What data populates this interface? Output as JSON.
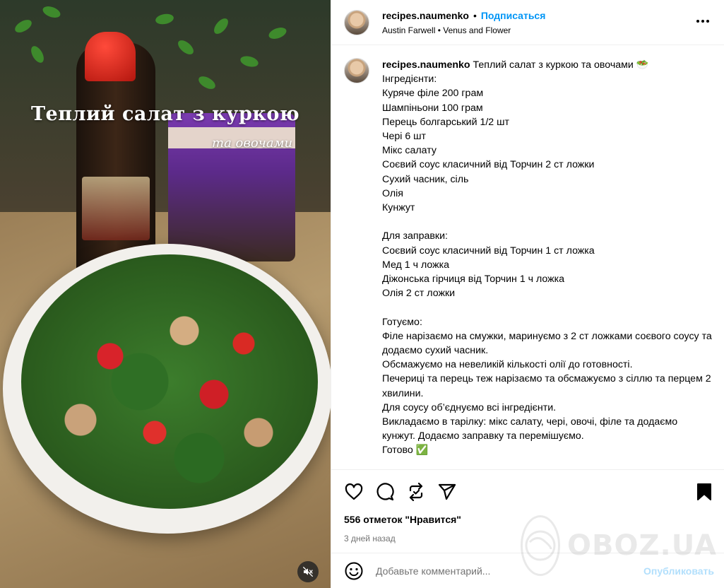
{
  "post": {
    "username": "recipes.naumenko",
    "follow_label": "Подписаться",
    "separator": "•",
    "audio": "Austin Farwell • Venus and Flower",
    "media_overlay_title": "Теплий салат з куркою",
    "media_overlay_subtitle": "та овочами"
  },
  "caption": {
    "title": "Теплий салат з куркою та овочами 🥗",
    "text": "Інгредієнти:\nКуряче філе 200 грам\nШампіньони 100 грам\nПерець болгарський 1/2 шт\nЧері 6 шт\nМікс салату\nСоєвий соус класичний від Торчин 2 ст ложки\nСухий часник, сіль\nОлія\nКунжут\n\nДля заправки:\nСоєвий соус класичний від Торчин 1 ст ложка\nМед 1 ч ложка\nДіжонська гірчиця від Торчин 1 ч ложка\nОлія 2 ст ложки\n\nГотуємо:\nФіле нарізаємо на смужки, маринуємо з 2 ст ложками соєвого соусу та додаємо сухий часник.\nОбсмажуємо на невеликій кількості олії до готовності.\nПечериці та перець теж нарізаємо та обсмажуємо з сіллю та перцем 2 хвилини.\nДля соусу об’єднуємо всі інгредієнти.\nВикладаємо в тарілку: мікс салату, чері, овочі, філе та додаємо кунжут. Додаємо заправку та перемішуємо.\nГотово ✅"
  },
  "stats": {
    "likes": "556 отметок \"Нравится\"",
    "time": "3 дней назад"
  },
  "comment": {
    "placeholder": "Добавьте комментарий...",
    "post_label": "Опубликовать"
  },
  "watermark": {
    "text": "OBOZ.UA"
  },
  "colors": {
    "accent": "#0095f6",
    "post_disabled": "#b2dffc",
    "secondary_text": "#737373",
    "divider": "#efefef"
  },
  "icons": {
    "like": "heart-icon",
    "comment": "comment-icon",
    "repost": "repost-icon",
    "share": "share-icon",
    "save": "bookmark-icon",
    "more": "more-icon",
    "emoji": "emoji-icon",
    "mute": "mute-icon"
  }
}
